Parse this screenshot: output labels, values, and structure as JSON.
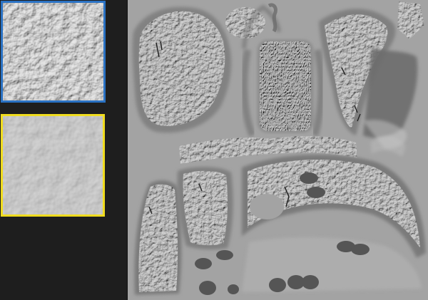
{
  "sidebar": {
    "thumbnails": [
      {
        "name": "leather-bumpy",
        "selected": true,
        "border_color": "#2a72c4"
      },
      {
        "name": "leather-smooth",
        "selected": false,
        "border_color": "#f0dc1e"
      }
    ]
  },
  "viewport": {
    "background_color": "#a3a3a3",
    "content": "uv-texture-atlas"
  }
}
